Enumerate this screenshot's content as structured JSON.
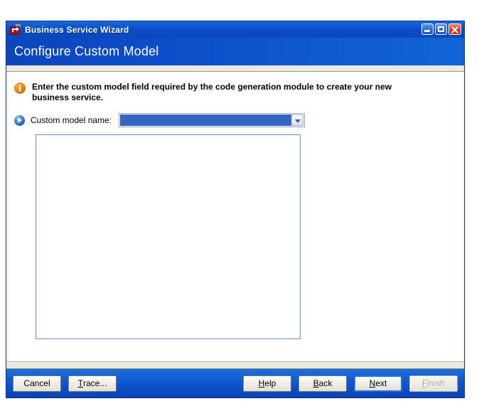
{
  "window": {
    "title": "Business Service Wizard",
    "icon": "wizard-app-icon",
    "controls": {
      "minimize": "minimize-icon",
      "maximize": "maximize-icon",
      "close": "close-icon"
    }
  },
  "header": {
    "title": "Configure Custom Model"
  },
  "info": {
    "icon": "info-icon",
    "line1": "Enter the custom model field required by the code generation module to create your new",
    "line2": "business service."
  },
  "field": {
    "bullet_icon": "blue-arrow-bullet-icon",
    "label": "Custom model name:",
    "combo": {
      "value": "",
      "placeholder": "",
      "arrow_icon": "chevron-down-icon"
    }
  },
  "list_panel": {
    "items": []
  },
  "buttons": {
    "cancel": {
      "label": "Cancel",
      "mnemonic": "",
      "state": "enabled"
    },
    "trace": {
      "label_pre": "",
      "mnemonic": "T",
      "label_post": "race...",
      "state": "enabled"
    },
    "help": {
      "label_pre": "",
      "mnemonic": "H",
      "label_post": "elp",
      "state": "enabled"
    },
    "back": {
      "label_pre": "",
      "mnemonic": "B",
      "label_post": "ack",
      "state": "enabled"
    },
    "next": {
      "label_pre": "",
      "mnemonic": "N",
      "label_post": "ext",
      "state": "default"
    },
    "finish": {
      "label_pre": "",
      "mnemonic": "F",
      "label_post": "inish",
      "state": "disabled"
    }
  },
  "colors": {
    "title_bar": "#0b4ec9",
    "header_band": "#0b4ec9",
    "selection": "#3465c0",
    "info_icon": "#e07b12",
    "panel_border": "#6f8fd0",
    "separator": "#ece9dd",
    "close_button": "#c42b13"
  }
}
